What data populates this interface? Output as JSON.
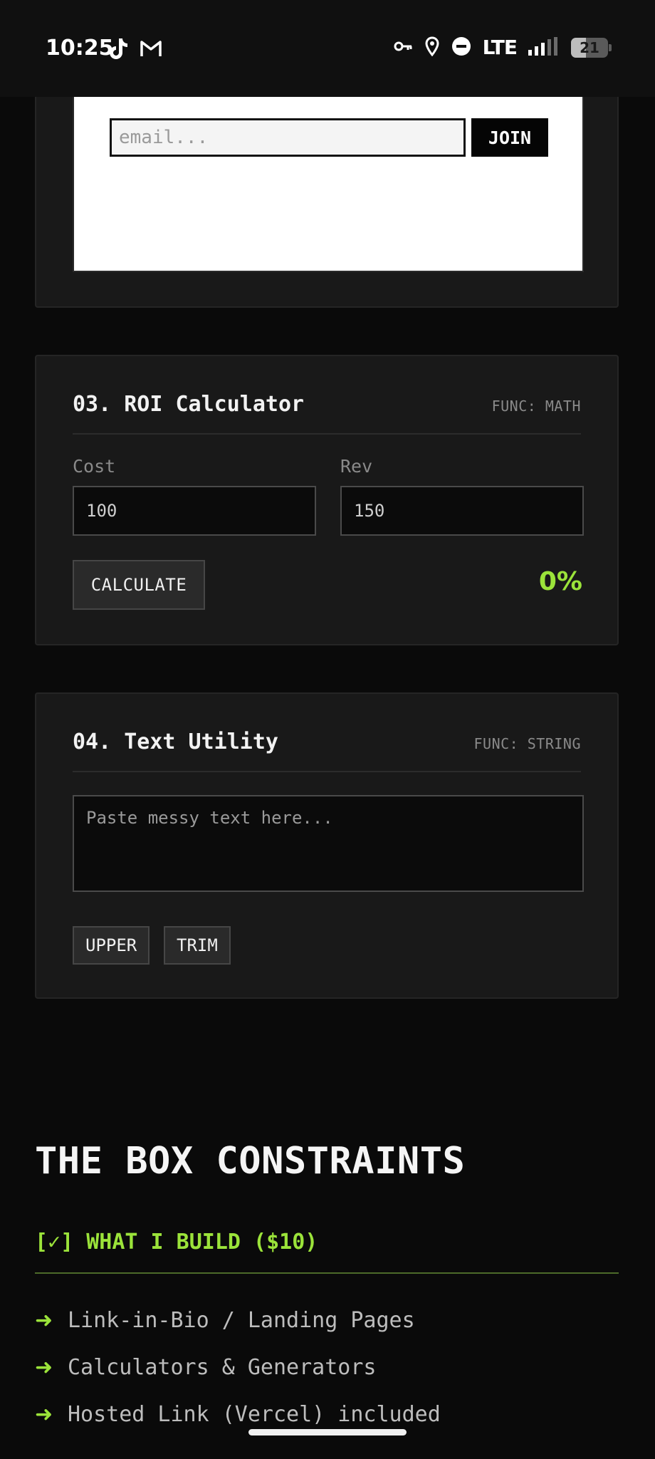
{
  "status_bar": {
    "time": "10:25",
    "network": "LTE",
    "battery": "21",
    "icons": [
      "tiktok-icon",
      "gmail-icon",
      "vpn-key-icon",
      "location-icon",
      "dnd-icon",
      "signal-icon",
      "battery-icon"
    ]
  },
  "newsletter": {
    "email_placeholder": "email...",
    "join_label": "JOIN"
  },
  "roi_calculator": {
    "title": "03. ROI Calculator",
    "func_tag": "FUNC: MATH",
    "cost_label": "Cost",
    "cost_value": "100",
    "rev_label": "Rev",
    "rev_value": "150",
    "calculate_label": "CALCULATE",
    "result": "0%"
  },
  "text_utility": {
    "title": "04. Text Utility",
    "func_tag": "FUNC: STRING",
    "textarea_placeholder": "Paste messy text here...",
    "upper_label": "UPPER",
    "trim_label": "TRIM"
  },
  "constraints": {
    "title": "THE BOX CONSTRAINTS",
    "build_heading": "[✓] WHAT I BUILD ($10)",
    "items": [
      {
        "arrow": "➜",
        "text": "Link-in-Bio / Landing Pages"
      },
      {
        "arrow": "➜",
        "text": "Calculators & Generators"
      },
      {
        "arrow": "➜",
        "text": "Hosted Link (Vercel) included"
      }
    ]
  },
  "colors": {
    "accent_green": "#9be33a",
    "background": "#0a0a0a",
    "card": "#191919"
  }
}
